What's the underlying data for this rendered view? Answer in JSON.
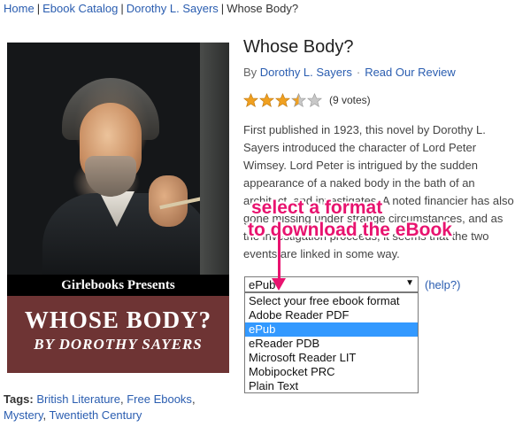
{
  "breadcrumb": {
    "home": "Home",
    "catalog": "Ebook Catalog",
    "author": "Dorothy L. Sayers",
    "current": "Whose Body?",
    "separator": "|"
  },
  "cover": {
    "publisher_band": "Girlebooks Presents",
    "title": "WHOSE BODY?",
    "author": "BY DOROTHY SAYERS",
    "band_color": "#000000",
    "title_color": "#6e3434"
  },
  "book": {
    "title": "Whose Body?",
    "by_prefix": "By",
    "author_link": "Dorothy L. Sayers",
    "review_link": "Read Our Review",
    "rating": 3.5,
    "rating_max": 5,
    "votes": "(9 votes)",
    "description_lines": [
      "First published in 1923, this novel by Dorothy L.",
      "Sayers introduced the character of Lord Peter",
      "Wimsey. Lord Peter is intrigued by the sudden",
      "appearance of a naked body in the bath of an",
      "architect, and investigates. A noted financier has also",
      "gone missing under strange circumstances, and as",
      "the investigation proceeds, it seems that the two",
      "events are linked in some way."
    ]
  },
  "format_select": {
    "selected": "ePub",
    "help_link": "(help?)",
    "options": [
      "Select your free ebook format",
      "Adobe Reader PDF",
      "ePub",
      "eReader PDB",
      "Microsoft Reader LIT",
      "Mobipocket PRC",
      "Plain Text"
    ],
    "highlight_color": "#3399ff"
  },
  "tags": {
    "label": "Tags:",
    "items": [
      "British Literature",
      "Free Ebooks",
      "Mystery",
      "Twentieth Century"
    ]
  },
  "annotation": {
    "line1": "select a format",
    "line2": "to download the eBook",
    "color": "#e8136f"
  },
  "colors": {
    "link": "#2a5db0",
    "star_filled": "#f0a020",
    "star_empty": "#c8c8c8"
  }
}
